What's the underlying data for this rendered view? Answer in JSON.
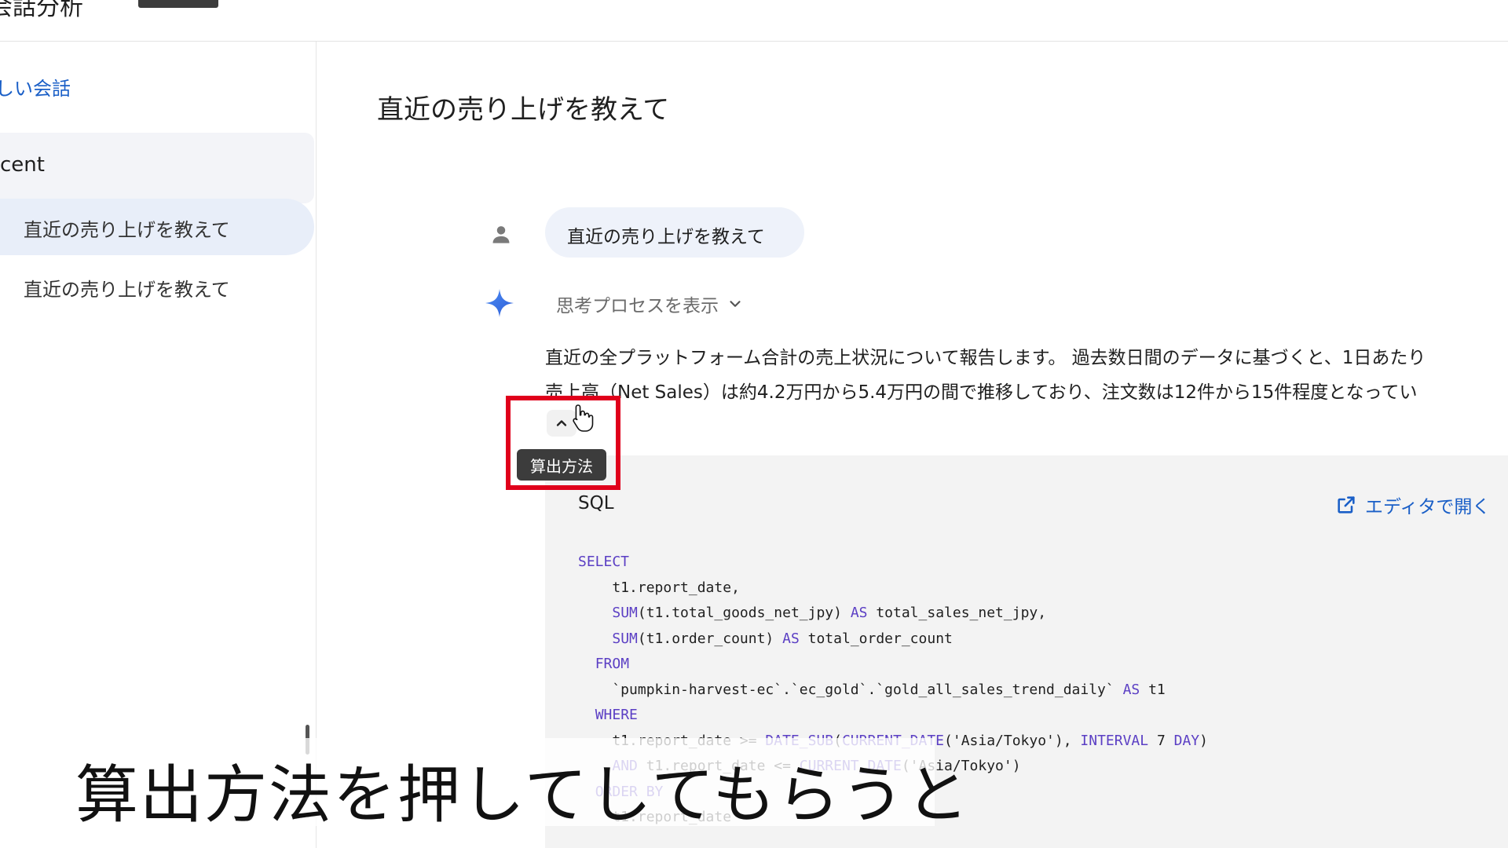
{
  "topbar": {
    "title": "会話分析"
  },
  "sidebar": {
    "new_chat": "しい会話",
    "recent_label": "cent",
    "items": [
      {
        "label": "直近の売り上げを教えて",
        "active": true
      },
      {
        "label": "直近の売り上げを教えて",
        "active": false
      }
    ]
  },
  "main": {
    "title": "直近の売り上げを教えて",
    "user_message": "直近の売り上げを教えて",
    "thinking_label": "思考プロセスを表示",
    "answer_lines": [
      "直近の全プラットフォーム合計の売上状況について報告します。 過去数日間のデータに基づくと、1日あたり",
      "売上高（Net Sales）は約4.2万円から5.4万円の間で推移しており、注文数は12件から15件程度となってい"
    ],
    "tooltip": "算出方法",
    "code_lang": "SQL",
    "open_editor": "エディタで開く",
    "code_lines": [
      "SELECT",
      "    t1.report_date,",
      "    SUM(t1.total_goods_net_jpy) AS total_sales_net_jpy,",
      "    SUM(t1.order_count) AS total_order_count",
      "  FROM",
      "    `pumpkin-harvest-ec`.`ec_gold`.`gold_all_sales_trend_daily` AS t1",
      "  WHERE",
      "    t1.report_date >= DATE_SUB(CURRENT_DATE('Asia/Tokyo'), INTERVAL 7 DAY)",
      "    AND t1.report_date <= CURRENT_DATE('Asia/Tokyo')",
      "  ORDER BY",
      "    t1.report_date"
    ]
  },
  "caption": "算出方法を押してしてもらうと",
  "colors": {
    "accent": "#1a5fc7",
    "highlight": "#e0001b",
    "keyword": "#5b3fc4"
  }
}
